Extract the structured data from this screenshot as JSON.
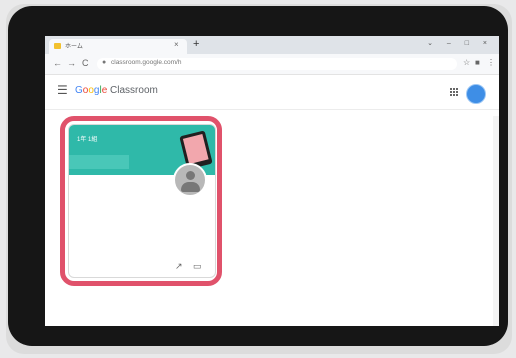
{
  "browser": {
    "tab_title": "ホーム",
    "tab_close": "×",
    "new_tab": "+",
    "window_controls": "⌄ – □ ×",
    "nav": {
      "back": "←",
      "forward": "→",
      "reload": "C"
    },
    "url": "classroom.google.com/h",
    "toolbar_right": [
      "☆",
      "■",
      "⋮"
    ]
  },
  "app": {
    "menu_icon": "☰",
    "logo_letters": [
      "G",
      "o",
      "o",
      "g",
      "l",
      "e"
    ],
    "product": "Classroom"
  },
  "card": {
    "title": "1年 1組",
    "stats_icon": "trending-up-icon",
    "folder_icon": "folder-icon"
  },
  "colors": {
    "highlight": "#e0526b",
    "banner": "#2fb9a9",
    "avatar": "#3e8ee6"
  }
}
